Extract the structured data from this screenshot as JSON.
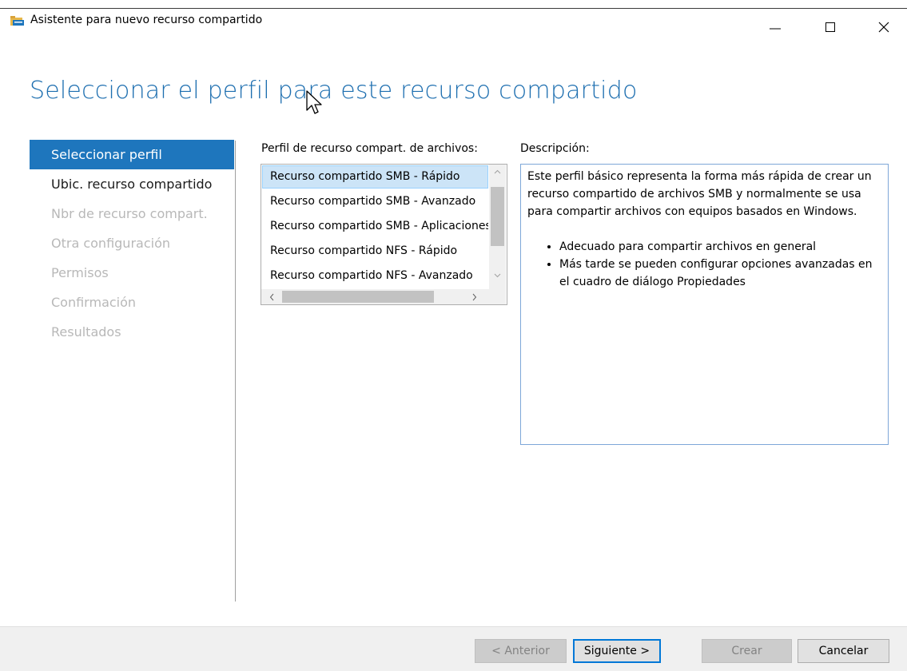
{
  "window": {
    "title": "Asistente para nuevo recurso compartido",
    "icon": "share-folder-icon"
  },
  "page": {
    "title": "Seleccionar el perfil para este recurso compartido"
  },
  "nav": {
    "items": [
      {
        "label": "Seleccionar perfil",
        "state": "active"
      },
      {
        "label": "Ubic. recurso compartido",
        "state": "enabled"
      },
      {
        "label": "Nbr de recurso compart.",
        "state": "disabled"
      },
      {
        "label": "Otra configuración",
        "state": "disabled"
      },
      {
        "label": "Permisos",
        "state": "disabled"
      },
      {
        "label": "Confirmación",
        "state": "disabled"
      },
      {
        "label": "Resultados",
        "state": "disabled"
      }
    ]
  },
  "profiles": {
    "label": "Perfil de recurso compart. de archivos:",
    "items": [
      "Recurso compartido SMB - Rápido",
      "Recurso compartido SMB - Avanzado",
      "Recurso compartido SMB - Aplicaciones",
      "Recurso compartido NFS - Rápido",
      "Recurso compartido NFS - Avanzado"
    ],
    "selected_index": 0
  },
  "description": {
    "label": "Descripción:",
    "text": "Este perfil básico representa la forma más rápida de crear un recurso compartido de archivos SMB y normalmente se usa para compartir archivos con equipos basados en Windows.",
    "bullets": [
      "Adecuado para compartir archivos en general",
      "Más tarde se pueden configurar opciones avanzadas en el cuadro de diálogo Propiedades"
    ]
  },
  "buttons": {
    "previous": "< Anterior",
    "next": "Siguiente >",
    "create": "Crear",
    "cancel": "Cancelar"
  },
  "colors": {
    "accent": "#1e76bd",
    "title": "#1e6fb0",
    "disabled_text": "#b8b8b8"
  }
}
